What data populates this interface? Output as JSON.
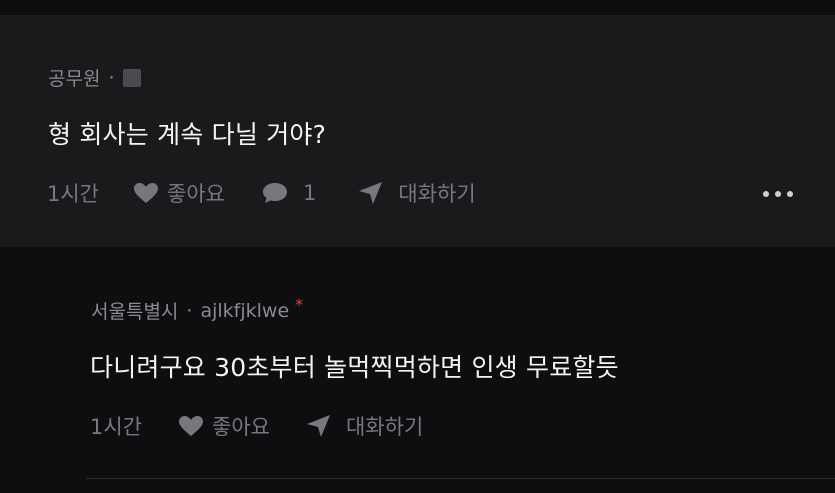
{
  "comment": {
    "author": "공무원",
    "separator": "·",
    "text": "형 회사는 계속 다닐 거야?",
    "time": "1시간",
    "like_label": "좋아요",
    "reply_count": "1",
    "chat_label": "대화하기"
  },
  "reply": {
    "location": "서울특별시",
    "separator": "·",
    "username": "ajlkfjklwe",
    "author_mark": "*",
    "text": "다니려구요 30초부터 놀먹찍먹하면 인생 무료할듯",
    "time": "1시간",
    "like_label": "좋아요",
    "chat_label": "대화하기"
  },
  "colors": {
    "background": "#0e0e10",
    "comment_background": "#1a1a1c",
    "author_mark": "#e0433a"
  }
}
